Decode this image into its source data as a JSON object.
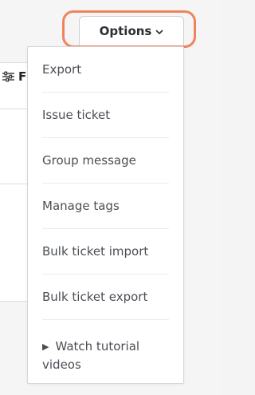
{
  "background": {
    "filter_label": "F"
  },
  "options_button": {
    "label": "Options",
    "highlight_color": "#f0835c"
  },
  "menu": {
    "items": [
      "Export",
      "Issue ticket",
      "Group message",
      "Manage tags",
      "Bulk ticket import",
      "Bulk ticket export"
    ],
    "tutorial": {
      "icon": "play-triangle-icon",
      "label": "Watch tutorial videos"
    }
  }
}
